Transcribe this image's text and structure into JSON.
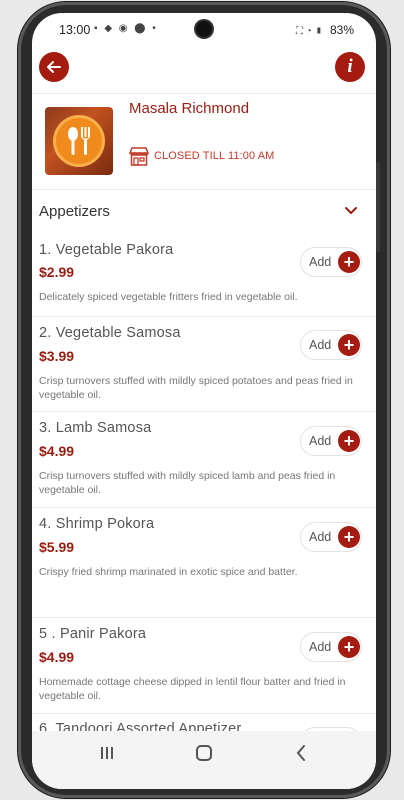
{
  "status_bar": {
    "time": "13:00",
    "battery": "83%"
  },
  "header": {
    "back_icon": "arrow-left-icon",
    "info_icon": "info-icon"
  },
  "restaurant": {
    "name": "Masala Richmond",
    "status": "CLOSED TILL 11:00 AM"
  },
  "menu": {
    "category": "Appetizers",
    "add_label": "Add",
    "items": [
      {
        "name": "1. Vegetable Pakora",
        "price": "$2.99",
        "description": "Delicately spiced vegetable fritters fried in vegetable oil."
      },
      {
        "name": "2. Vegetable Samosa",
        "price": "$3.99",
        "description": "Crisp turnovers stuffed with mildly spiced potatoes and peas fried in vegetable oil."
      },
      {
        "name": "3. Lamb Samosa",
        "price": "$4.99",
        "description": "Crisp turnovers stuffed with mildly spiced lamb and peas fried in vegetable oil."
      },
      {
        "name": "4. Shrimp Pokora",
        "price": "$5.99",
        "description": "Crispy fried shrimp marinated in exotic spice and batter."
      },
      {
        "name": "5 . Panir Pakora",
        "price": "$4.99",
        "description": "Homemade cottage cheese dipped in lentil flour batter and fried in vegetable oil."
      },
      {
        "name": "6. Tandoori Assorted Appetizer",
        "price": "",
        "description": ""
      }
    ]
  },
  "colors": {
    "accent": "#a41b0f",
    "price": "#9a1b10",
    "closed": "#c23a2a"
  }
}
